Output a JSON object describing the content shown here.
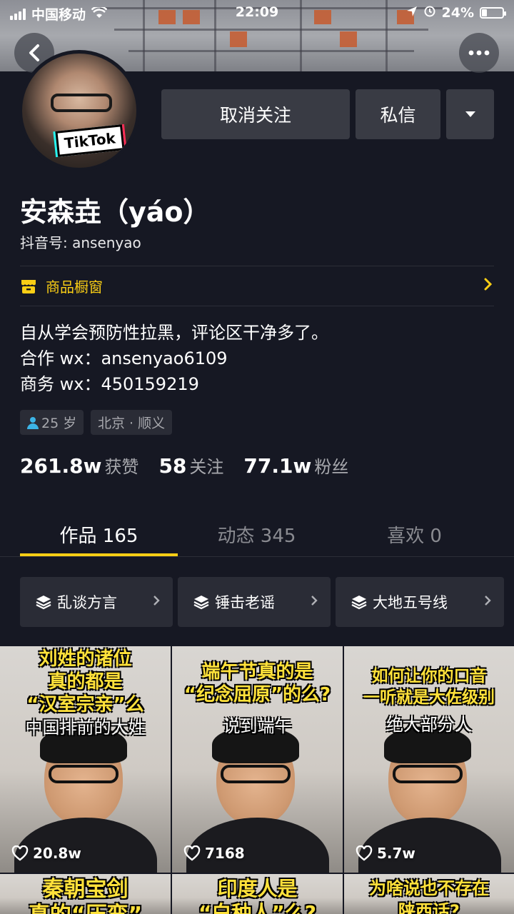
{
  "status_bar": {
    "carrier": "中国移动",
    "time": "22:09",
    "battery": "24%",
    "battery_level": 0.24
  },
  "profile": {
    "name": "安森垚（yáo）",
    "douyin_id": "抖音号: ansenyao",
    "avatar_label": "TikTok",
    "unfollow_label": "取消关注",
    "message_label": "私信"
  },
  "shop": {
    "label": "商品橱窗"
  },
  "bio": {
    "line1": "自从学会预防性拉黑，评论区干净多了。",
    "line2": "合作 wx：ansenyao6109",
    "line3": "商务 wx：450159219"
  },
  "tags": {
    "age": "25 岁",
    "location": "北京 · 顺义"
  },
  "stats": {
    "likes_num": "261.8w",
    "likes_label": "获赞",
    "following_num": "58",
    "following_label": "关注",
    "fans_num": "77.1w",
    "fans_label": "粉丝"
  },
  "tabs": [
    {
      "label": "作品 165"
    },
    {
      "label": "动态 345"
    },
    {
      "label": "喜欢 0"
    }
  ],
  "collections": [
    {
      "label": "乱谈方言"
    },
    {
      "label": "锤击老谣"
    },
    {
      "label": "大地五号线"
    }
  ],
  "videos": [
    {
      "line1": "刘姓的诸位",
      "line2": "真的都是",
      "line3": "“汉室宗亲”么",
      "sub": "中国排前的大姓",
      "likes": "20.8w"
    },
    {
      "line1": "端午节真的是",
      "line2": "“纪念屈原”的么?",
      "line3": "",
      "sub": "说到端午",
      "likes": "7168"
    },
    {
      "line1": "如何让你的口音",
      "line2": "一听就是大佐级别",
      "line3": "",
      "sub": "绝大部分人",
      "likes": "5.7w"
    },
    {
      "line1": "秦朝宝剑",
      "line2": "真的“压弯”",
      "line3": "",
      "sub": "",
      "likes": ""
    },
    {
      "line1": "印度人是",
      "line2": "“白种人”么?",
      "line3": "",
      "sub": "",
      "likes": ""
    },
    {
      "line1": "为啥说也不存在",
      "line2": "陕西话?",
      "line3": "",
      "sub": "",
      "likes": ""
    }
  ],
  "colors": {
    "background": "#161823",
    "accent_yellow": "#face15",
    "button_gray": "#393b44"
  }
}
